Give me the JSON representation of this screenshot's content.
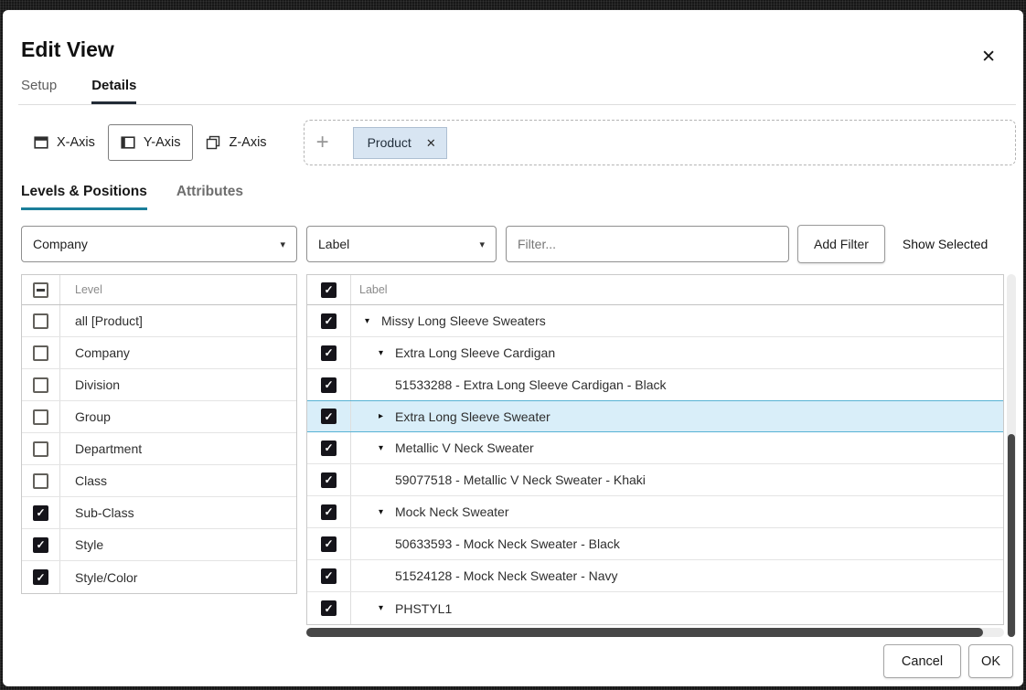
{
  "colors": {
    "accent_teal": "#1b7e9a",
    "selection_bg": "#d9eef9",
    "selection_border": "#57b2d4",
    "chip_bg": "#d8e5f2",
    "checkbox_fill": "#15141a"
  },
  "dialog": {
    "title": "Edit View",
    "close_icon": "✕"
  },
  "tabs": {
    "setup": "Setup",
    "details": "Details"
  },
  "axes": {
    "x_label": "X-Axis",
    "y_label": "Y-Axis",
    "z_label": "Z-Axis",
    "add_icon": "+",
    "chip": {
      "label": "Product",
      "remove_icon": "✕"
    }
  },
  "subtabs": {
    "levels": "Levels & Positions",
    "attributes": "Attributes"
  },
  "levels_panel": {
    "dropdown_value": "Company",
    "dropdown_icon": "▾",
    "column_header": "Level",
    "rows": [
      {
        "label": "all [Product]",
        "checked": false
      },
      {
        "label": "Company",
        "checked": false
      },
      {
        "label": "Division",
        "checked": false
      },
      {
        "label": "Group",
        "checked": false
      },
      {
        "label": "Department",
        "checked": false
      },
      {
        "label": "Class",
        "checked": false
      },
      {
        "label": "Sub-Class",
        "checked": true
      },
      {
        "label": "Style",
        "checked": true
      },
      {
        "label": "Style/Color",
        "checked": true
      }
    ]
  },
  "positions_panel": {
    "dropdown_value": "Label",
    "dropdown_icon": "▾",
    "filter_placeholder": "Filter...",
    "add_filter_label": "Add Filter",
    "show_selected_label": "Show Selected",
    "column_header": "Label",
    "expanded_icon": "▾",
    "collapsed_icon": "▸",
    "rows": [
      {
        "label": "Missy Long Sleeve Sweaters",
        "checked": true,
        "indent": 1,
        "state": "expanded",
        "selected": false
      },
      {
        "label": "Extra Long Sleeve Cardigan",
        "checked": true,
        "indent": 2,
        "state": "expanded",
        "selected": false
      },
      {
        "label": "51533288 - Extra Long Sleeve Cardigan - Black",
        "checked": true,
        "indent": 3,
        "state": "leaf",
        "selected": false
      },
      {
        "label": "Extra Long Sleeve Sweater",
        "checked": true,
        "indent": 2,
        "state": "collapsed",
        "selected": true
      },
      {
        "label": "Metallic V Neck Sweater",
        "checked": true,
        "indent": 2,
        "state": "expanded",
        "selected": false
      },
      {
        "label": "59077518 - Metallic V Neck Sweater - Khaki",
        "checked": true,
        "indent": 3,
        "state": "leaf",
        "selected": false
      },
      {
        "label": "Mock Neck Sweater",
        "checked": true,
        "indent": 2,
        "state": "expanded",
        "selected": false
      },
      {
        "label": "50633593 - Mock Neck Sweater - Black",
        "checked": true,
        "indent": 3,
        "state": "leaf",
        "selected": false
      },
      {
        "label": "51524128 - Mock Neck Sweater - Navy",
        "checked": true,
        "indent": 3,
        "state": "leaf",
        "selected": false
      },
      {
        "label": "PHSTYL1",
        "checked": true,
        "indent": 2,
        "state": "expanded",
        "selected": false
      }
    ]
  },
  "footer": {
    "cancel_label": "Cancel",
    "ok_label": "OK"
  }
}
